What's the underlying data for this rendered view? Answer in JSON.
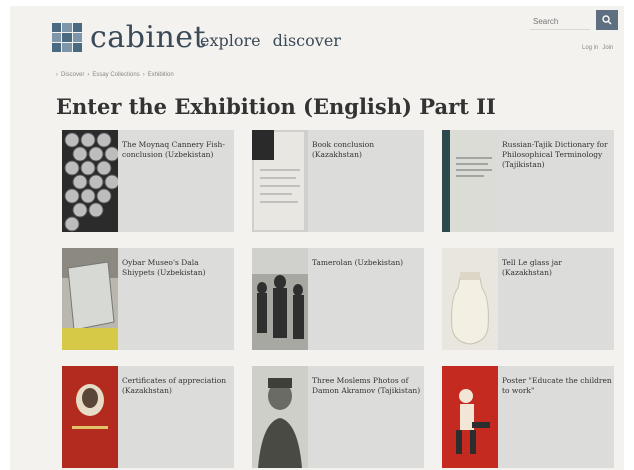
{
  "header": {
    "logo_text": "cabinet",
    "nav": [
      "explore",
      "discover"
    ],
    "search_placeholder": "Search",
    "auth": [
      "Log in",
      "Join"
    ]
  },
  "breadcrumb": [
    "Discover",
    "Essay Collections",
    "Exhibition"
  ],
  "page_title": "Enter the Exhibition (English) Part II",
  "cards": [
    {
      "label": "The Moynaq Cannery Fish-conclusion (Uzbekistan)",
      "thumb": "fish-cans"
    },
    {
      "label": "Book conclusion (Kazakhstan)",
      "thumb": "document"
    },
    {
      "label": "Russian-Tajik Dictionary for Philosophical Terminology (Tajikistan)",
      "thumb": "dictionary"
    },
    {
      "label": "Oybar Museo's Dala Shiypets (Uzbekistan)",
      "thumb": "glass-case"
    },
    {
      "label": "Tamerolan (Uzbekistan)",
      "thumb": "crowd-photo"
    },
    {
      "label": "Tell Le glass jar (Kazakhstan)",
      "thumb": "jar"
    },
    {
      "label": "Certificates of appreciation (Kazakhstan)",
      "thumb": "red-certificate"
    },
    {
      "label": "Three Moslems Photos of Damon Akramov (Tajikistan)",
      "thumb": "portrait"
    },
    {
      "label": "Poster \"Educate the children to work\"",
      "thumb": "poster"
    }
  ]
}
